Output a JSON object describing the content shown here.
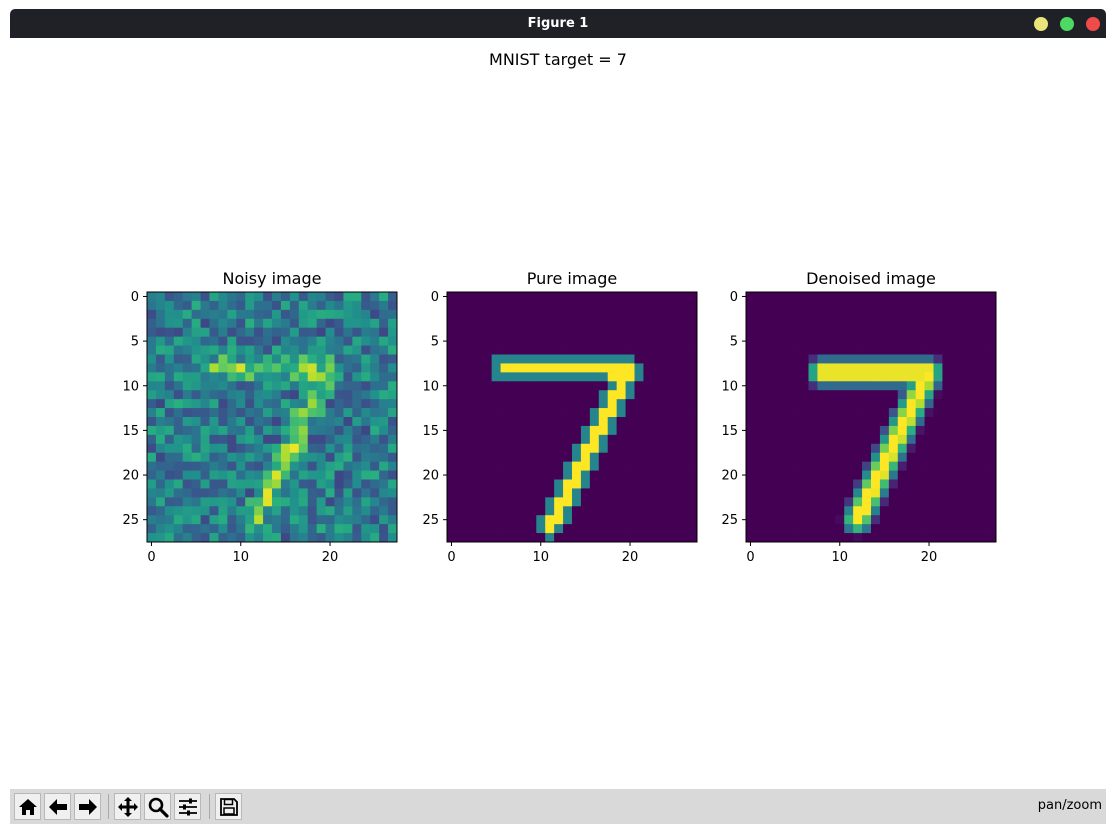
{
  "window": {
    "title": "Figure 1",
    "buttons": {
      "minimize_color": "#e8e37a",
      "maximize_color": "#4cd964",
      "close_color": "#f04a4a"
    }
  },
  "figure": {
    "suptitle": "MNIST target = 7",
    "panels": [
      {
        "title": "Noisy image"
      },
      {
        "title": "Pure image"
      },
      {
        "title": "Denoised image"
      }
    ]
  },
  "toolbar": {
    "buttons": [
      {
        "icon": "home-icon",
        "tooltip": ""
      },
      {
        "icon": "back-arrow-icon"
      },
      {
        "icon": "forward-arrow-icon"
      },
      {
        "icon": "pan-move-icon"
      },
      {
        "icon": "zoom-magnifier-icon"
      },
      {
        "icon": "configure-subplots-icon"
      },
      {
        "icon": "save-floppy-icon"
      }
    ],
    "status": "pan/zoom"
  },
  "chart_data": [
    {
      "type": "heatmap",
      "title": "Noisy image",
      "xlabel": "",
      "ylabel": "",
      "xlim": [
        -0.5,
        27.5
      ],
      "ylim": [
        27.5,
        -0.5
      ],
      "xticks": [
        0,
        10,
        20
      ],
      "yticks": [
        0,
        5,
        10,
        15,
        20,
        25
      ],
      "colormap": "viridis",
      "noise": true
    },
    {
      "type": "heatmap",
      "title": "Pure image",
      "xlabel": "",
      "ylabel": "",
      "xlim": [
        -0.5,
        27.5
      ],
      "ylim": [
        27.5,
        -0.5
      ],
      "xticks": [
        0,
        10,
        20
      ],
      "yticks": [
        0,
        5,
        10,
        15,
        20,
        25
      ],
      "colormap": "viridis",
      "strokes": [
        {
          "from": [
            6,
            8
          ],
          "to": [
            20,
            8.5
          ],
          "width": 1.1
        },
        {
          "from": [
            20,
            8.5
          ],
          "to": [
            11,
            25.5
          ],
          "width": 1.2
        }
      ]
    },
    {
      "type": "heatmap",
      "title": "Denoised image",
      "xlabel": "",
      "ylabel": "",
      "xlim": [
        -0.5,
        27.5
      ],
      "ylim": [
        27.5,
        -0.5
      ],
      "xticks": [
        0,
        10,
        20
      ],
      "yticks": [
        0,
        5,
        10,
        15,
        20,
        25
      ],
      "colormap": "viridis",
      "strokes": [
        {
          "from": [
            8,
            8.5
          ],
          "to": [
            20,
            8.5
          ],
          "width": 1.3
        },
        {
          "from": [
            20,
            8.5
          ],
          "to": [
            12,
            25
          ],
          "width": 1.3
        }
      ],
      "blur": true
    }
  ]
}
